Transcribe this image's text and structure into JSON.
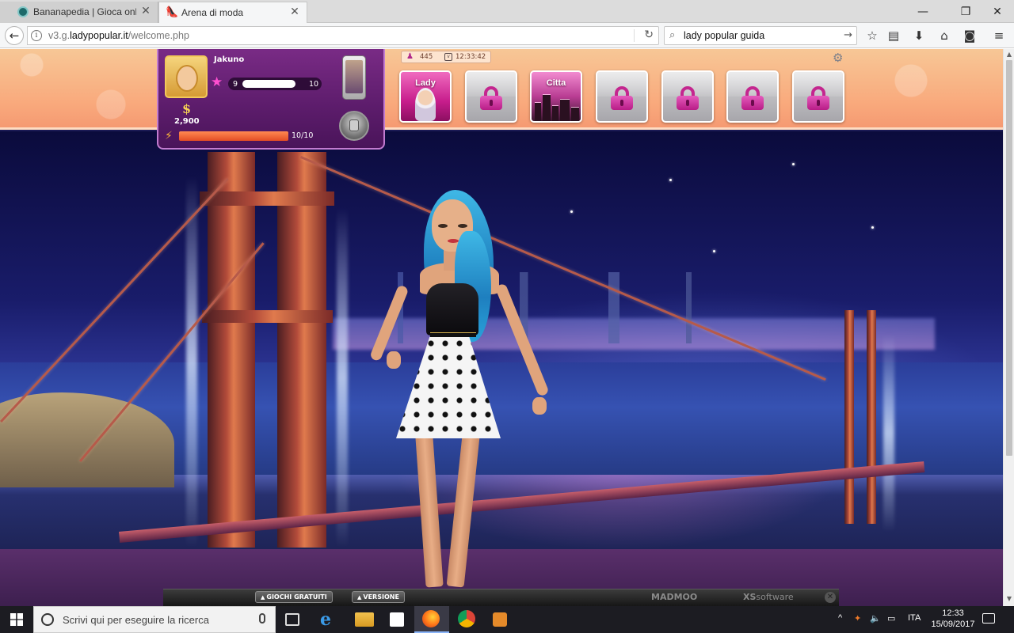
{
  "browser": {
    "tabs": [
      {
        "label": "Bananapedia | Gioca online e",
        "active": false
      },
      {
        "label": "Arena di moda",
        "active": true
      }
    ],
    "url_prefix": "v3.g.",
    "url_domain": "ladypopular.it",
    "url_path": "/welcome.php",
    "search_value": "lady popular guida"
  },
  "profile": {
    "name": "Jakuno",
    "level": "9",
    "next_level": "10",
    "level_progress": 0.7,
    "currency_symbol": "$",
    "money": "2,900",
    "energy_text": "10/10",
    "energy_fraction": 1.0
  },
  "counters": {
    "fans": "445",
    "time": "12:33:42"
  },
  "tiles": [
    {
      "label": "Lady",
      "locked": false
    },
    {
      "label": "",
      "locked": true
    },
    {
      "label": "Citta",
      "locked": false
    },
    {
      "label": "",
      "locked": true
    },
    {
      "label": "",
      "locked": true
    },
    {
      "label": "",
      "locked": true
    },
    {
      "label": "",
      "locked": true
    }
  ],
  "gamebar": {
    "free_games": "GIOCHI GRATUITI",
    "version": "VERSIONE",
    "madmoo": "MADMOO",
    "xs": "XS",
    "software": "software"
  },
  "taskbar": {
    "search_placeholder": "Scrivi qui per eseguire la ricerca",
    "language": "ITA",
    "time": "12:33",
    "date": "15/09/2017"
  },
  "colors": {
    "accent_pink": "#c71d8c",
    "panel_purple": "#5c1c6b",
    "energy_orange": "#e34d24"
  }
}
